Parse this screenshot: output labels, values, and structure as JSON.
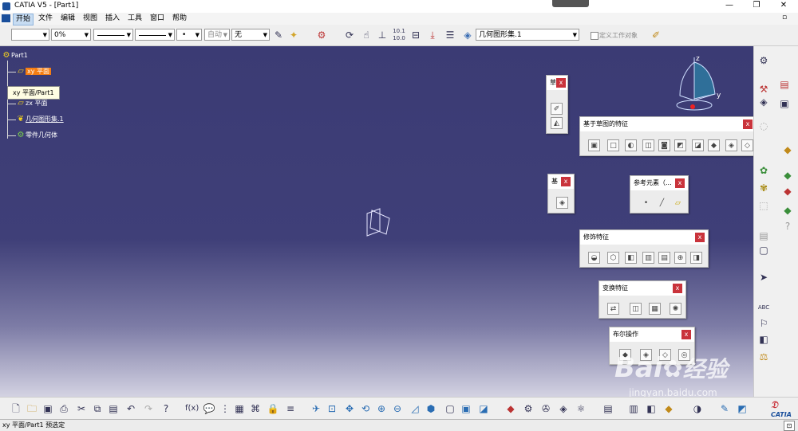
{
  "window": {
    "title": "CATIA V5 - [Part1]",
    "controls": [
      "—",
      "❐",
      "✕"
    ]
  },
  "menu": {
    "items": [
      "开始",
      "文件",
      "编辑",
      "视图",
      "插入",
      "工具",
      "窗口",
      "帮助"
    ]
  },
  "toolbar": {
    "transparency": "0%",
    "label_auto": "自动",
    "layer": "无",
    "geometric_set": "几何图形集.1",
    "define_work_object": "定义工作对象"
  },
  "tree": {
    "root": "Part1",
    "nodes": [
      "xy 平面",
      "yz 平面",
      "zx 平面",
      "几何图形集.1",
      "零件几何体"
    ],
    "tooltip": "xy 平面/Part1"
  },
  "compass": {
    "z": "z",
    "y": "y"
  },
  "floating_toolbars": {
    "small_top": {
      "title": "草"
    },
    "sketch_based": {
      "title": "基于草图的特征"
    },
    "base": {
      "title": "基"
    },
    "reference": {
      "title": "参考元素（..."
    },
    "dress_up": {
      "title": "修饰特征"
    },
    "transform": {
      "title": "变换特征"
    },
    "boolean": {
      "title": "布尔操作"
    },
    "close_label": "x"
  },
  "statusbar": {
    "text": "xy 平面/Part1 预选定"
  },
  "watermark": {
    "main": "Bai",
    "text": "经验",
    "url": "jingyan.baidu.com"
  },
  "brand": {
    "logo": "CATIA"
  },
  "colors": {
    "viewport_top": "#3b3b74",
    "selection": "#f57d12",
    "close_button": "#c9333b"
  }
}
